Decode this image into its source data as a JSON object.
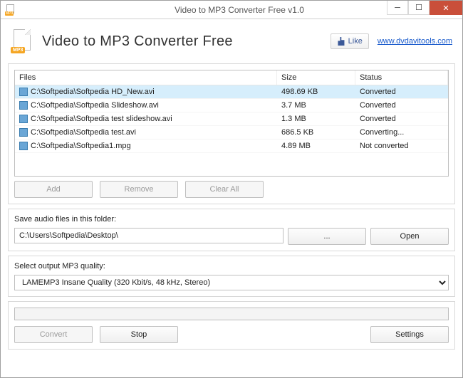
{
  "window": {
    "title": "Video to MP3 Converter Free v1.0"
  },
  "header": {
    "app_title": "Video to MP3 Converter Free",
    "like_label": "Like",
    "site_link_text": "www.dvdavitools.com",
    "mp3_badge": "MP3"
  },
  "files_list": {
    "columns": {
      "files": "Files",
      "size": "Size",
      "status": "Status"
    },
    "rows": [
      {
        "path": "C:\\Softpedia\\Softpedia HD_New.avi",
        "size": "498.69 KB",
        "status": "Converted",
        "selected": true
      },
      {
        "path": "C:\\Softpedia\\Softpedia Slideshow.avi",
        "size": "3.7 MB",
        "status": "Converted",
        "selected": false
      },
      {
        "path": "C:\\Softpedia\\Softpedia test slideshow.avi",
        "size": "1.3 MB",
        "status": "Converted",
        "selected": false
      },
      {
        "path": "C:\\Softpedia\\Softpedia test.avi",
        "size": "686.5 KB",
        "status": "Converting...",
        "selected": false
      },
      {
        "path": "C:\\Softpedia\\Softpedia1.mpg",
        "size": "4.89 MB",
        "status": "Not converted",
        "selected": false
      }
    ]
  },
  "buttons": {
    "add": "Add",
    "remove": "Remove",
    "clear_all": "Clear All",
    "browse": "...",
    "open": "Open",
    "convert": "Convert",
    "stop": "Stop",
    "settings": "Settings"
  },
  "output_folder": {
    "label": "Save audio files in this folder:",
    "value": "C:\\Users\\Softpedia\\Desktop\\"
  },
  "quality": {
    "label": "Select output MP3 quality:",
    "selected": "LAMEMP3 Insane Quality (320 Kbit/s, 48 kHz, Stereo)"
  }
}
